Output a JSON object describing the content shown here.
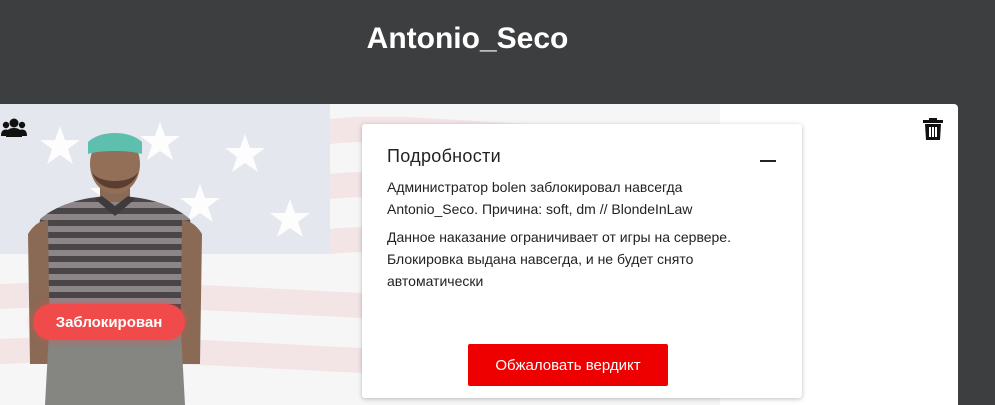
{
  "header": {
    "title": "Antonio_Seco"
  },
  "profile": {
    "status_badge": "Заблокирован",
    "icons": {
      "group": "users-icon",
      "delete": "trash-icon"
    }
  },
  "details": {
    "title": "Подробности",
    "text_1": "Администратор bolen заблокировал навсегда Antonio_Seco. Причина: soft, dm // BlondeInLaw",
    "text_2": "Данное наказание ограничивает от игры на сервере. Блокировка выдана навсегда, и не будет снято автоматически",
    "appeal_button": "Обжаловать вердикт"
  },
  "colors": {
    "header_bg": "#3d3e40",
    "badge": "#f04a4a",
    "appeal_button": "#ee0000"
  }
}
